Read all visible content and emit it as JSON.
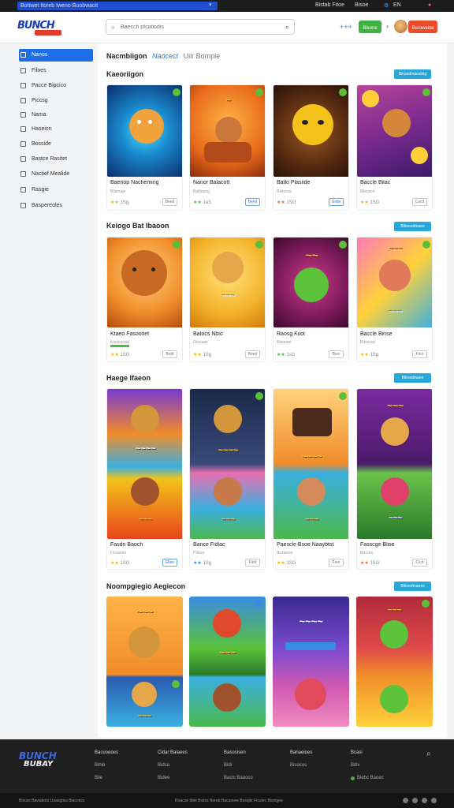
{
  "topbar": {
    "notice": "Bottwet Itoreb Iweno Buobwacit",
    "links": [
      "Bistab Fitoe",
      "Bisoe"
    ],
    "lang": "EN"
  },
  "header": {
    "logo_text": "BUNCH",
    "search_placeholder": "Baecch pfcatiodis",
    "icon_grid_label": "+++",
    "green_button": "Bisone",
    "red_button": "Beroweise",
    "colors": {
      "primary": "#1e6ee8",
      "green": "#3fb23f",
      "red": "#ec4b2c",
      "teal": "#29a7d6"
    }
  },
  "sidebar": {
    "items": [
      {
        "label": "Nanos",
        "active": true
      },
      {
        "label": "Filoes",
        "active": false
      },
      {
        "label": "Pacce Bipcico",
        "active": false
      },
      {
        "label": "Piccsg",
        "active": false
      },
      {
        "label": "Nama",
        "active": false
      },
      {
        "label": "Haseion",
        "active": false
      },
      {
        "label": "Bosside",
        "active": false
      },
      {
        "label": "Bastce Rasitet",
        "active": false
      },
      {
        "label": "Nactief Mealide",
        "active": false
      },
      {
        "label": "Rasgie",
        "active": false
      },
      {
        "label": "Baspereoles",
        "active": false
      }
    ]
  },
  "main": {
    "tabs": [
      "Nacmbiigon",
      "Naocect",
      "Uiir Bompie"
    ],
    "sections": [
      {
        "title": "Kaeoriigon",
        "button": "Bikoedmaesbiig",
        "cards": [
          {
            "name": "Baenop Nacheming",
            "sub": "Bilanuge",
            "rating": "1Sg",
            "btn": "Beed"
          },
          {
            "name": "Nanor Balacott",
            "sub": "Batlioung",
            "rating": "1aS",
            "btn": "Beed"
          },
          {
            "name": "Batlo Plasiide",
            "sub": "Ristoraa",
            "rating": "1SG",
            "btn": "Giide"
          },
          {
            "name": "Baccle Bilac",
            "sub": "Bilxsace",
            "rating": "1SG",
            "btn": "Cacd"
          }
        ]
      },
      {
        "title": "Keiogo Bat Ibaoon",
        "button": "Bikeeedmaes",
        "cards": [
          {
            "name": "Ktaeo Fasooxet",
            "sub": "Ktsstsssue",
            "rating": "1SG",
            "btn": "Bald"
          },
          {
            "name": "Batocs Nbio",
            "sub": "Filscaan",
            "rating": "1Sg",
            "btn": "Beed"
          },
          {
            "name": "Raosg Kiiot",
            "sub": "Bitoetan",
            "rating": "1sG",
            "btn": "Riec"
          },
          {
            "name": "Baccle Binse",
            "sub": "Bitocoss",
            "rating": "1Sg",
            "btn": "Fieo"
          }
        ]
      },
      {
        "title": "Haege Ifaeon",
        "button": "Bikoedmaee",
        "cards": [
          {
            "name": "Fasdn Baoch",
            "sub": "Fissacee",
            "rating": "1SG",
            "btn": "Ellee"
          },
          {
            "name": "Barice Fidlac",
            "sub": "Pilioss",
            "rating": "1Sg",
            "btn": "Fidd"
          },
          {
            "name": "Paescle Bsoe Naaybtst",
            "sub": "Bicheoss",
            "rating": "1SG",
            "btn": "Fiee"
          },
          {
            "name": "Fasscge Blise",
            "sub": "Bilcoes",
            "rating": "1SG",
            "btn": "Cicd"
          }
        ]
      },
      {
        "title": "Noompgiegio Aegiecon",
        "button": "Bikoedmaees",
        "cards": []
      }
    ]
  },
  "footer": {
    "logo_text": "BUNCH",
    "logo_text2": "BUBAY",
    "columns": [
      {
        "head": "Bacuoeoes",
        "links": [
          "Bihle",
          "Bile"
        ]
      },
      {
        "head": "Cidar Baiaees",
        "links": [
          "Bidsa",
          "Bidee"
        ]
      },
      {
        "head": "Basosisen",
        "links": [
          "Bidi",
          "Bacis Baaoco"
        ]
      },
      {
        "head": "Banaeioes",
        "links": [
          "Bisocos"
        ]
      },
      {
        "head": "Bcasi",
        "links": [
          "Bitiv",
          "Biebc Baoec"
        ]
      }
    ]
  },
  "bottombar": {
    "left": "Bixuss Baviaboto Uoasgtiss Biaconcs",
    "center": "Roacse Ibiet Bisise Noreb Bacasvee Bosqiie Fisutec Bisnigee"
  }
}
